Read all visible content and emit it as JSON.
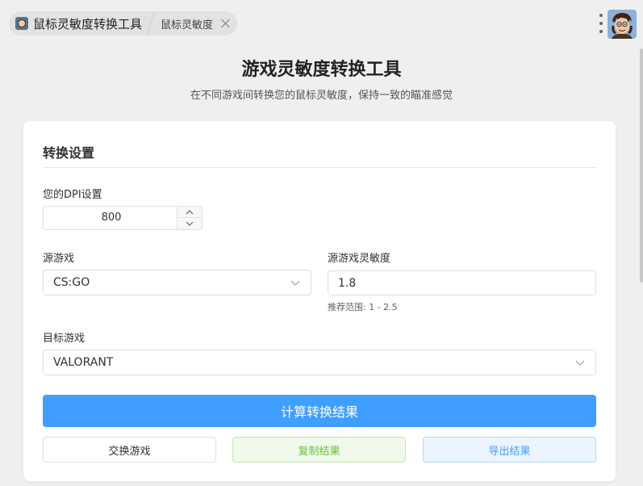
{
  "browser": {
    "app_tab_title": "鼠标灵敏度转换工具",
    "page_tab_title": "鼠标灵敏度"
  },
  "header": {
    "title": "游戏灵敏度转换工具",
    "subtitle": "在不同游戏间转换您的鼠标灵敏度，保持一致的瞄准感觉"
  },
  "settings": {
    "section_title": "转换设置",
    "dpi_label": "您的DPI设置",
    "dpi_value": "800",
    "source_game_label": "源游戏",
    "source_game_value": "CS:GO",
    "source_sens_label": "源游戏灵敏度",
    "source_sens_value": "1.8",
    "source_sens_hint": "推荐范围: 1 - 2.5",
    "target_game_label": "目标游戏",
    "target_game_value": "VALORANT"
  },
  "actions": {
    "calculate_label": "计算转换结果",
    "swap_label": "交换游戏",
    "copy_label": "复制结果",
    "export_label": "导出结果"
  },
  "colors": {
    "primary": "#409eff",
    "success": "#67c23a",
    "background": "#efefef"
  },
  "icons": [
    "favicon-icon",
    "close-icon",
    "more-vertical-icon",
    "avatar",
    "chevron-up-icon",
    "chevron-down-icon"
  ]
}
